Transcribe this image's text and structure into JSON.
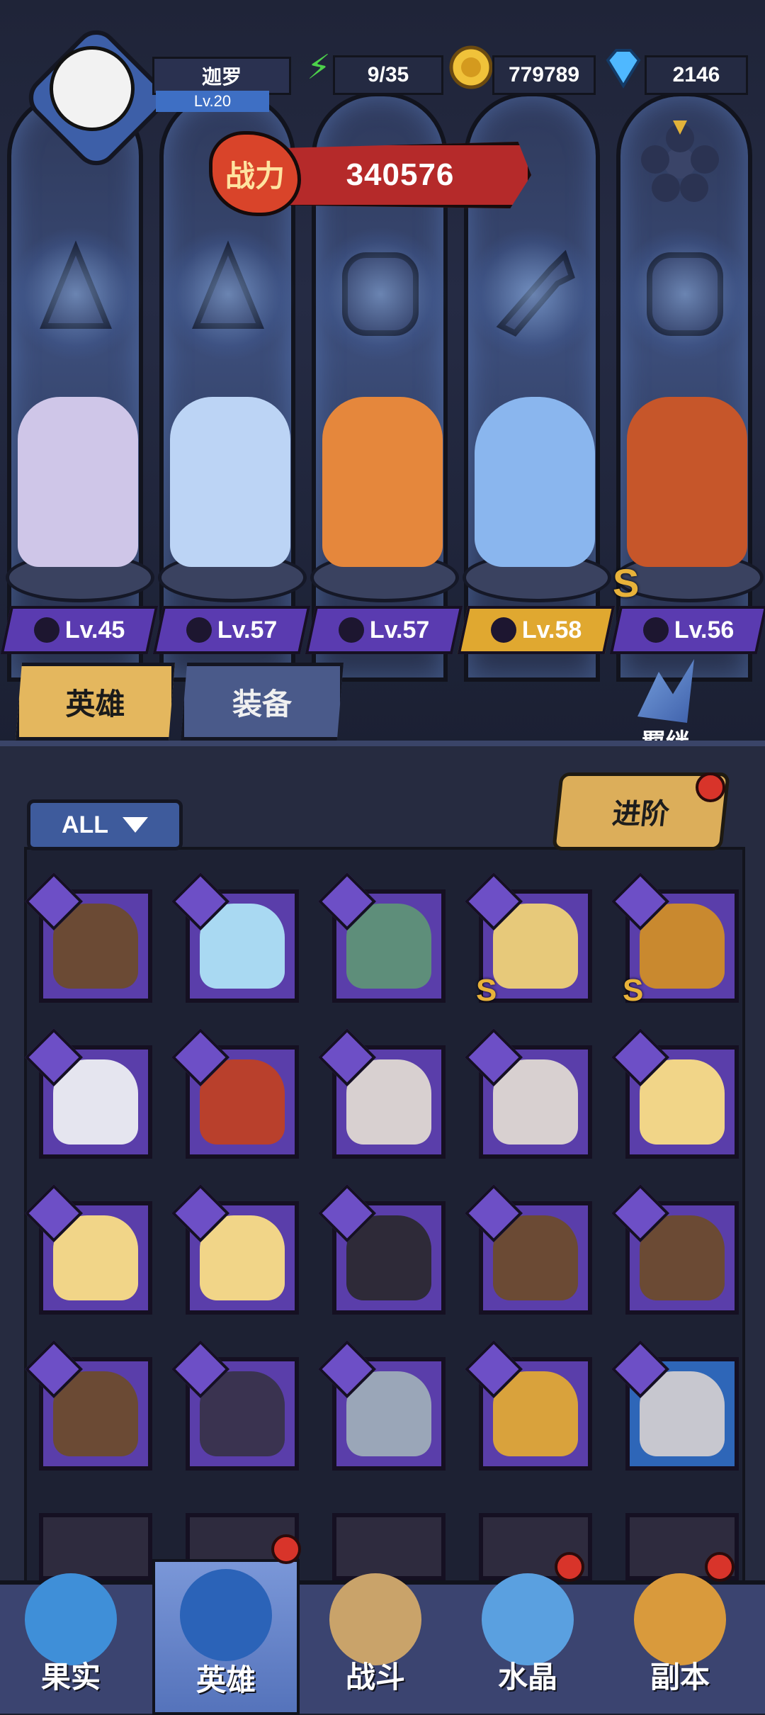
{
  "player": {
    "name": "迦罗",
    "level": "Lv.20"
  },
  "resources": {
    "energy": "9/35",
    "gold": "779789",
    "gems": "2146"
  },
  "power": {
    "badge": "战力",
    "value": "340576"
  },
  "team": [
    {
      "level": "Lv.45",
      "class_icon": "hat-icon",
      "color": "#5a3bb0",
      "figure": "#cfc6e8"
    },
    {
      "level": "Lv.57",
      "class_icon": "hat-icon",
      "color": "#5a3bb0",
      "figure": "#bcd4f5"
    },
    {
      "level": "Lv.57",
      "class_icon": "claw-icon",
      "color": "#5a3bb0",
      "figure": "#e5873c"
    },
    {
      "level": "Lv.58",
      "class_icon": "wrench-icon",
      "color": "#e0a830",
      "figure": "#8ab6ee",
      "tier": ""
    },
    {
      "level": "Lv.56",
      "class_icon": "claw-icon",
      "color": "#5a3bb0",
      "figure": "#c6562a",
      "tier": "S"
    }
  ],
  "tabs": {
    "heroes": "英雄",
    "equipment": "装备"
  },
  "bond_label": "羁绊",
  "filter_label": "ALL",
  "advance_label": "进阶",
  "grid": [
    [
      {
        "c": "#6b4a34",
        "t": ""
      },
      {
        "c": "#a9d9f2",
        "t": ""
      },
      {
        "c": "#5e8e7a",
        "t": ""
      },
      {
        "c": "#e7c97a",
        "t": "S"
      },
      {
        "c": "#c9892f",
        "t": "S"
      }
    ],
    [
      {
        "c": "#e5e5ef",
        "t": ""
      },
      {
        "c": "#b9402c",
        "t": ""
      },
      {
        "c": "#d8d0d0",
        "t": ""
      },
      {
        "c": "#d8d0d0",
        "t": ""
      },
      {
        "c": "#f1d588",
        "t": ""
      }
    ],
    [
      {
        "c": "#f1d588",
        "t": ""
      },
      {
        "c": "#f1d588",
        "t": ""
      },
      {
        "c": "#2e2a38",
        "t": ""
      },
      {
        "c": "#6b4a34",
        "t": ""
      },
      {
        "c": "#6b4a34",
        "t": ""
      }
    ],
    [
      {
        "c": "#6b4a34",
        "t": ""
      },
      {
        "c": "#3a3350",
        "t": ""
      },
      {
        "c": "#9aa6b8",
        "t": ""
      },
      {
        "c": "#d9a23c",
        "t": ""
      },
      {
        "c": "#c7c7cf",
        "t": ""
      }
    ]
  ],
  "nav": [
    {
      "label": "果实",
      "color": "#3f8fd8"
    },
    {
      "label": "英雄",
      "color": "#2b63b8"
    },
    {
      "label": "战斗",
      "color": "#c9a36a"
    },
    {
      "label": "水晶",
      "color": "#5aa0e0"
    },
    {
      "label": "副本",
      "color": "#d99a3c"
    }
  ]
}
